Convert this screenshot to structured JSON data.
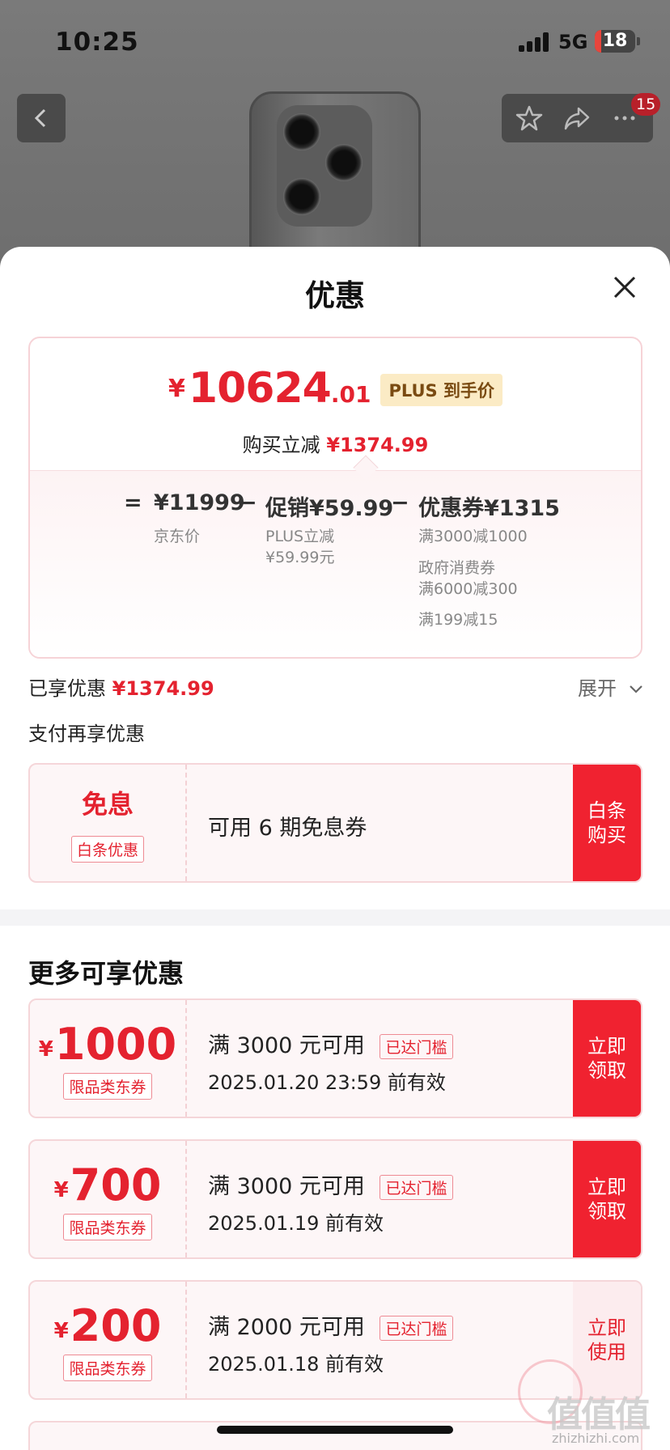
{
  "status": {
    "time": "10:25",
    "network": "5G",
    "battery": "18"
  },
  "header": {
    "cart_badge": "15"
  },
  "sheet": {
    "title": "优惠",
    "price": {
      "yen": "¥",
      "integer": "10624",
      "decimal": ".01",
      "plus_tag": "PLUS 到手价",
      "buy_cut_label": "购买立减",
      "buy_cut_value": "¥1374.99"
    },
    "breakdown": {
      "equals": "=",
      "jd_price": "¥11999",
      "jd_price_label": "京东价",
      "minus1": "−",
      "promo": "促销¥59.99",
      "promo_sub1": "PLUS立减",
      "promo_sub2": "¥59.99元",
      "minus2": "−",
      "coupon": "优惠券¥1315",
      "coupon_sub1": "满3000减1000",
      "coupon_sub2": "政府消费券",
      "coupon_sub3": "满6000减300",
      "coupon_sub4": "满199减15"
    },
    "enjoyed_label": "已享优惠",
    "enjoyed_value": "¥1374.99",
    "expand_label": "展开",
    "pay_more_label": "支付再享优惠",
    "baitiao": {
      "title": "免息",
      "tag": "白条优惠",
      "desc": "可用 6 期免息券",
      "action": "白条购买"
    },
    "more_title": "更多可享优惠",
    "coupons": [
      {
        "yen": "¥",
        "amount": "1000",
        "tag": "限品类东券",
        "condition": "满 3000 元可用",
        "reached": "已达门槛",
        "valid": "2025.01.20 23:59 前有效",
        "action": "立即领取"
      },
      {
        "yen": "¥",
        "amount": "700",
        "tag": "限品类东券",
        "condition": "满 3000 元可用",
        "reached": "已达门槛",
        "valid": "2025.01.19 前有效",
        "action": "立即领取"
      },
      {
        "yen": "¥",
        "amount": "200",
        "tag": "限品类东券",
        "condition": "满 2000 元可用",
        "reached": "已达门槛",
        "valid": "2025.01.18 前有效",
        "action": "立即使用"
      }
    ]
  },
  "watermark": {
    "main": "值值值",
    "sub": "zhizhizhi.com"
  },
  "colors": {
    "accent_red": "#e4222f",
    "action_red": "#f02230",
    "plus_gold": "#fbebc5"
  }
}
